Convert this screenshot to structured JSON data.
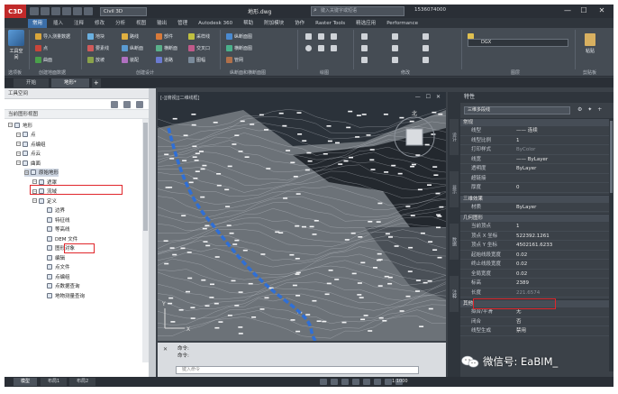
{
  "window": {
    "app_logo": "C3D",
    "workspace": "Civil 3D",
    "title": "地形.dwg",
    "search_placeholder": "键入关键字或短语",
    "user": "1536074000",
    "minimize": "—",
    "maximize": "☐",
    "close": "✕"
  },
  "ribbon_tabs": [
    "常用",
    "插入",
    "注释",
    "修改",
    "分析",
    "视图",
    "输出",
    "管理",
    "Autodesk 360",
    "帮助",
    "附加模块",
    "协作",
    "Raster Tools",
    "精选应用",
    "Performance"
  ],
  "ribbon": {
    "toolspace": "工具空间",
    "g1": [
      "导入测量数据",
      "点",
      "曲面"
    ],
    "g2": [
      "地块",
      "要素线",
      "放坡"
    ],
    "g3": [
      "路线",
      "纵断面",
      "装配"
    ],
    "g4": [
      "部件",
      "横断面",
      "道路"
    ],
    "g5": [
      "采样线",
      "交叉口",
      "图幅"
    ],
    "g6": [
      "纵断面图",
      "横断面图",
      "管网"
    ],
    "groups": [
      "选项板",
      "创建地面数据",
      "创建设计",
      "纵断面和横断面图",
      "绘图",
      "修改",
      "图层",
      "剪贴板"
    ],
    "layer": "DGX",
    "clipboard": "粘贴"
  },
  "doc_tabs": [
    "开始",
    "地形*"
  ],
  "toolspace": {
    "header": "工具空间",
    "view": "当前图形视图",
    "tree": [
      {
        "label": "地形",
        "level": 0
      },
      {
        "label": "点",
        "level": 1
      },
      {
        "label": "点编组",
        "level": 1
      },
      {
        "label": "点云",
        "level": 1
      },
      {
        "label": "曲面",
        "level": 1
      },
      {
        "label": "原始地形",
        "level": 2
      },
      {
        "label": "遮罩",
        "level": 3
      },
      {
        "label": "流域",
        "level": 3
      },
      {
        "label": "定义",
        "level": 3
      },
      {
        "label": "边界",
        "level": 4
      },
      {
        "label": "特征线",
        "level": 4
      },
      {
        "label": "等高线",
        "level": 4
      },
      {
        "label": "DEM 文件",
        "level": 4
      },
      {
        "label": "图形对象",
        "level": 4
      },
      {
        "label": "编辑",
        "level": 4
      },
      {
        "label": "点文件",
        "level": 4
      },
      {
        "label": "点编组",
        "level": 4
      },
      {
        "label": "点数据查询",
        "level": 4
      },
      {
        "label": "地物测量查询",
        "level": 4
      }
    ],
    "tabs": [
      "浏览",
      "测量"
    ]
  },
  "viewport": {
    "label": "[-][俯视][二维线框]",
    "controls": "— ☐ ✕",
    "compass": "北",
    "axis_x": "X",
    "axis_y": "Y"
  },
  "command": {
    "history": [
      "命令:",
      "命令:"
    ],
    "placeholder": "键入命令",
    "close": "✕"
  },
  "side_tabs": [
    "设计",
    "显示",
    "数据",
    "注释"
  ],
  "properties": {
    "title": "特性",
    "selection": "三维多段线",
    "tools": "⚙ ✦ +",
    "groups": {
      "general": "常规",
      "3d": "三维效果",
      "geometry": "几何图形",
      "misc": "其他"
    },
    "general_rows": [
      {
        "k": "线型",
        "v": "—— 连续"
      },
      {
        "k": "线型比例",
        "v": "1"
      },
      {
        "k": "打印样式",
        "v": "ByColor",
        "dim": true
      },
      {
        "k": "线宽",
        "v": "—— ByLayer"
      },
      {
        "k": "透明度",
        "v": "ByLayer"
      },
      {
        "k": "超链接",
        "v": ""
      },
      {
        "k": "厚度",
        "v": "0"
      }
    ],
    "d3_rows": [
      {
        "k": "材质",
        "v": "ByLayer"
      }
    ],
    "geom_rows": [
      {
        "k": "当前顶点",
        "v": "1"
      },
      {
        "k": "顶点 X 坐标",
        "v": "522392.1261"
      },
      {
        "k": "顶点 Y 坐标",
        "v": "4502161.6233"
      },
      {
        "k": "起始线段宽度",
        "v": "0.02"
      },
      {
        "k": "终止线段宽度",
        "v": "0.02"
      },
      {
        "k": "全局宽度",
        "v": "0.02"
      },
      {
        "k": "标高",
        "v": "2389"
      },
      {
        "k": "长度",
        "v": "221.6574",
        "dim": true
      }
    ],
    "misc_rows": [
      {
        "k": "拟合/平滑",
        "v": "无"
      },
      {
        "k": "闭合",
        "v": "否"
      },
      {
        "k": "线型生成",
        "v": "禁用"
      }
    ]
  },
  "status": {
    "layouts": [
      "模型",
      "布局1",
      "布局2"
    ],
    "scale": "1:1000"
  },
  "watermark": "微信号: EaBIM_",
  "colors": {
    "accent": "#3b6ea8",
    "highlight": "#e0262b",
    "river": "#2f6fd6"
  }
}
